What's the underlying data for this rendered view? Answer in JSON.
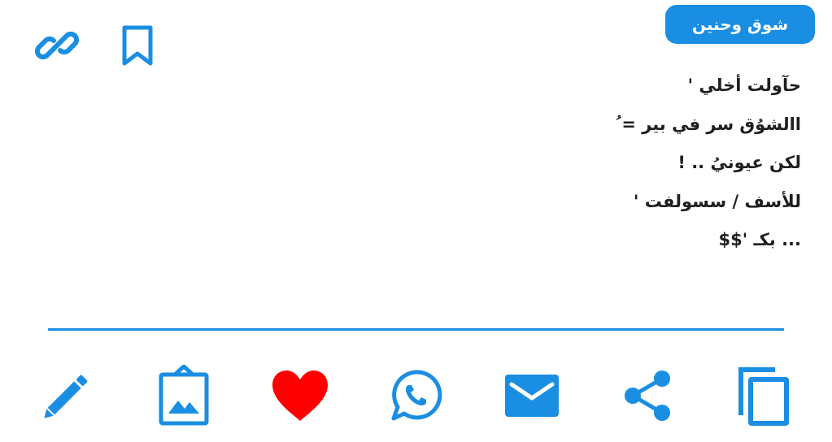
{
  "tag": {
    "label": "شوق وحنين"
  },
  "poem": {
    "lines": [
      "حآولت أخلي '",
      "االشوُق سر في بير = ُ",
      "لكن عيونيُ .. !",
      "للأسف / سسولفت '",
      "... بكـ '$$"
    ]
  },
  "icons": {
    "top": [
      "link-icon",
      "bookmark-icon"
    ],
    "actions": [
      "pencil-icon",
      "image-frame-icon",
      "heart-icon",
      "whatsapp-icon",
      "envelope-icon",
      "share-icon",
      "copy-icon"
    ]
  },
  "colors": {
    "accent": "#1a8ee3",
    "heart": "#ff0000",
    "text": "#1f1f1f"
  }
}
